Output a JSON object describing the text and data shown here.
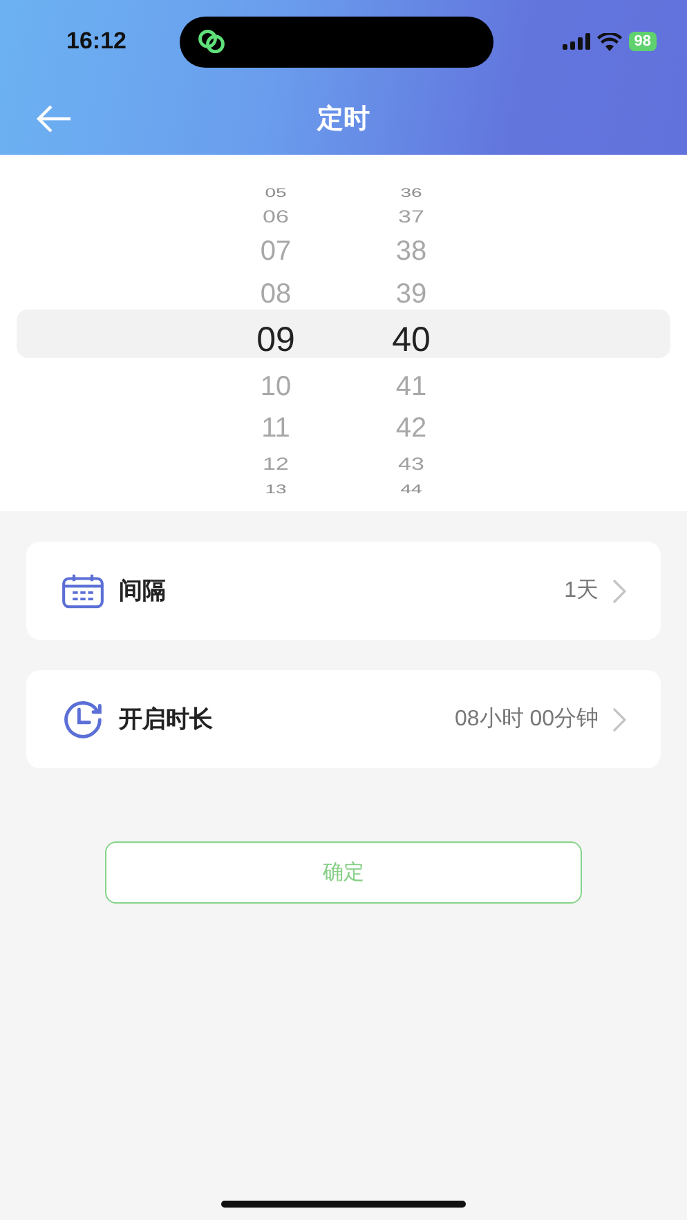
{
  "status_bar": {
    "time": "16:12",
    "battery": "98"
  },
  "nav": {
    "title": "定时"
  },
  "picker": {
    "columns": [
      {
        "items": [
          {
            "label": "05",
            "selected": false
          },
          {
            "label": "06",
            "selected": false
          },
          {
            "label": "07",
            "selected": false
          },
          {
            "label": "08",
            "selected": false
          },
          {
            "label": "09",
            "selected": true
          },
          {
            "label": "10",
            "selected": false
          },
          {
            "label": "11",
            "selected": false
          },
          {
            "label": "12",
            "selected": false
          },
          {
            "label": "13",
            "selected": false
          }
        ]
      },
      {
        "items": [
          {
            "label": "36",
            "selected": false
          },
          {
            "label": "37",
            "selected": false
          },
          {
            "label": "38",
            "selected": false
          },
          {
            "label": "39",
            "selected": false
          },
          {
            "label": "40",
            "selected": true
          },
          {
            "label": "41",
            "selected": false
          },
          {
            "label": "42",
            "selected": false
          },
          {
            "label": "43",
            "selected": false
          },
          {
            "label": "44",
            "selected": false
          }
        ]
      }
    ]
  },
  "settings": [
    {
      "kind": "calendar",
      "label": "间隔",
      "value": "1天"
    },
    {
      "kind": "clock",
      "label": "开启时长",
      "value": "08小时 00分钟"
    }
  ],
  "confirm_button": "确定"
}
